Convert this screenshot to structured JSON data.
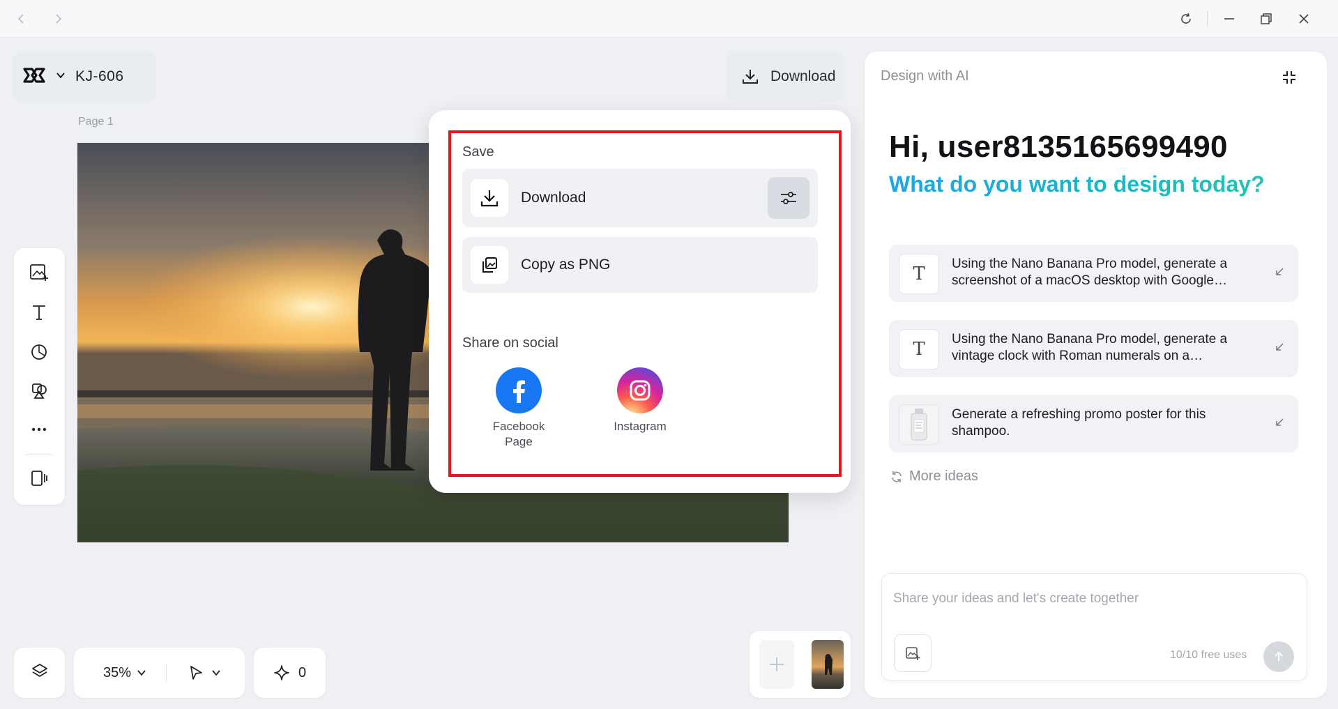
{
  "window": {
    "nav_back": "back",
    "nav_forward": "forward",
    "controls": [
      "refresh-icon",
      "minimize-icon",
      "restore-icon",
      "close-icon"
    ]
  },
  "project": {
    "name": "KJ-606"
  },
  "canvas": {
    "page_label": "Page 1"
  },
  "header": {
    "download_label": "Download"
  },
  "popup": {
    "save_label": "Save",
    "download_label": "Download",
    "copy_png_label": "Copy as PNG",
    "share_label": "Share on social",
    "social": [
      {
        "label_line1": "Facebook",
        "label_line2": "Page"
      },
      {
        "label_line1": "Instagram",
        "label_line2": ""
      }
    ]
  },
  "bottom": {
    "zoom": "35%",
    "credits": "0"
  },
  "ai_panel": {
    "title": "Design with AI",
    "greeting": "Hi, user8135165699490",
    "subtitle": "What do you want to design today?",
    "ideas": [
      {
        "icon": "T",
        "text": "Using the Nano Banana Pro model, generate a screenshot of a macOS desktop with Google…"
      },
      {
        "icon": "T",
        "text": "Using the Nano Banana Pro model, generate a vintage clock with Roman numerals on a…"
      },
      {
        "icon": "",
        "text": "Generate a refreshing promo poster for this shampoo."
      }
    ],
    "more_ideas": "More ideas",
    "chat_placeholder": "Share your ideas and let's create together",
    "free_uses": "10/10 free uses"
  },
  "colors": {
    "highlight": "#e8141b",
    "accent_gradient_start": "#1aa6e8",
    "accent_gradient_end": "#1fc6b3",
    "facebook": "#1877f2"
  }
}
